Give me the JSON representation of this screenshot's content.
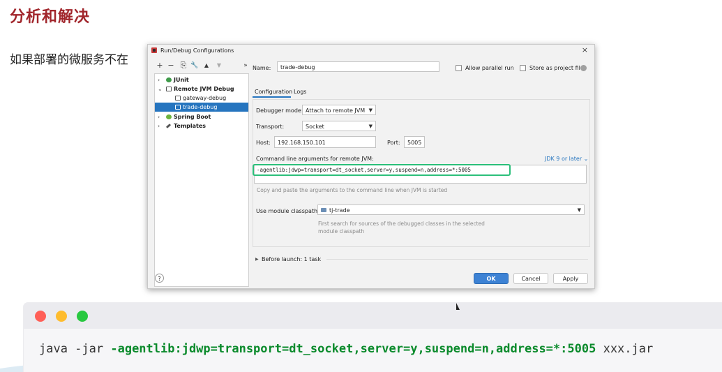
{
  "slide": {
    "title": "分析和解决",
    "subtitle": "如果部署的微服务不在"
  },
  "dialog": {
    "title": "Run/Debug Configurations",
    "close_glyph": "×",
    "toolbar": {
      "add": "+",
      "remove": "−",
      "copy": "⎘",
      "edit": "🔧",
      "up": "▲",
      "down": "▼",
      "expand": "»"
    },
    "tree": [
      {
        "label": "JUnit",
        "chevron": "›",
        "level": 0
      },
      {
        "label": "Remote JVM Debug",
        "chevron": "⌄",
        "level": 0
      },
      {
        "label": "gateway-debug",
        "level": 1
      },
      {
        "label": "trade-debug",
        "level": 1,
        "selected": true
      },
      {
        "label": "Spring Boot",
        "chevron": "›",
        "level": 0
      },
      {
        "label": "Templates",
        "chevron": "›",
        "level": 0
      }
    ],
    "name_label": "Name:",
    "name_value": "trade-debug",
    "allow_parallel_label": "Allow parallel run",
    "store_as_project_label": "Store as project file",
    "tabs": [
      "Configuration",
      "Logs"
    ],
    "debugger_mode_label": "Debugger mode:",
    "debugger_mode_value": "Attach to remote JVM",
    "transport_label": "Transport:",
    "transport_value": "Socket",
    "host_label": "Host:",
    "host_value": "192.168.150.101",
    "port_label": "Port:",
    "port_value": "5005",
    "cmd_label": "Command line arguments for remote JVM:",
    "jdk_link": "JDK 9 or later ⌄",
    "cmd_value": "-agentlib:jdwp=transport=dt_socket,server=y,suspend=n,address=*:5005",
    "cmd_hint": "Copy and paste the arguments to the command line when JVM is started",
    "module_label": "Use module classpath:",
    "module_value": "tj-trade",
    "module_hint_1": "First search for sources of the debugged classes in the selected",
    "module_hint_2": "module classpath",
    "before_launch": "Before launch: 1 task",
    "help": "?",
    "ok": "OK",
    "cancel": "Cancel",
    "apply": "Apply"
  },
  "terminal": {
    "prefix": "java -jar ",
    "highlight": "-agentlib:jdwp=transport=dt_socket,server=y,suspend=n,address=*:5005",
    "suffix": " xxx.jar",
    "dot_colors": [
      "#ff5f57",
      "#febc2e",
      "#28c840"
    ]
  },
  "colors": {
    "title_red": "#a1262c",
    "selection_blue": "#2675bf",
    "highlight_green": "#2bbf7a",
    "code_green": "#0a8a2b"
  }
}
